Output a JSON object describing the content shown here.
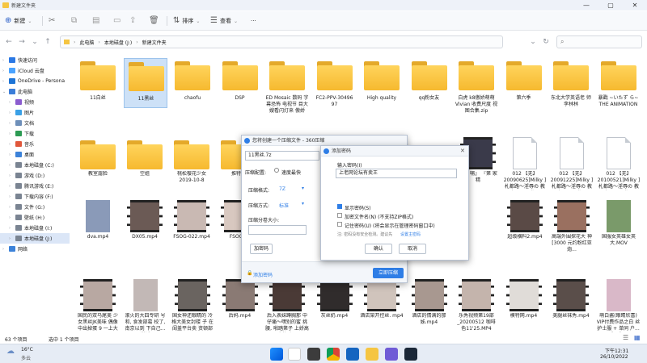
{
  "window": {
    "title": "新建文件夹"
  },
  "ribbon": {
    "new_label": "新建",
    "sort_label": "排序",
    "view_label": "查看",
    "more_label": "···"
  },
  "address": {
    "path": [
      "此电脑",
      "本地磁盘 (J:)",
      "新建文件夹"
    ]
  },
  "sidebar": {
    "items": [
      {
        "label": "快速访问",
        "color": "#2b78e4",
        "chev": "›",
        "indent": 0
      },
      {
        "label": "iCloud 云盘",
        "color": "#4aa3ff",
        "chev": "›",
        "indent": 0
      },
      {
        "label": "OneDrive - Persona",
        "color": "#1e74d6",
        "chev": "›",
        "indent": 0
      },
      {
        "label": "此电脑",
        "color": "#3b7dd8",
        "chev": "⌄",
        "indent": 0
      },
      {
        "label": "视频",
        "color": "#8b5ccf",
        "chev": "›",
        "indent": 1
      },
      {
        "label": "图片",
        "color": "#3aa0e6",
        "chev": "›",
        "indent": 1
      },
      {
        "label": "文档",
        "color": "#6e8fb9",
        "chev": "›",
        "indent": 1
      },
      {
        "label": "下载",
        "color": "#2c9b53",
        "chev": "›",
        "indent": 1
      },
      {
        "label": "音乐",
        "color": "#e0573b",
        "chev": "›",
        "indent": 1
      },
      {
        "label": "桌面",
        "color": "#3c82d9",
        "chev": "›",
        "indent": 1
      },
      {
        "label": "本地磁盘 (C:)",
        "color": "#7a8492",
        "chev": "›",
        "indent": 1
      },
      {
        "label": "游戏 (D:)",
        "color": "#7a8492",
        "chev": "›",
        "indent": 1
      },
      {
        "label": "腾讯游戏 (E:)",
        "color": "#7a8492",
        "chev": "›",
        "indent": 1
      },
      {
        "label": "下载内容 (F:)",
        "color": "#7a8492",
        "chev": "›",
        "indent": 1
      },
      {
        "label": "文件 (G:)",
        "color": "#7a8492",
        "chev": "›",
        "indent": 1
      },
      {
        "label": "壁纸 (H:)",
        "color": "#7a8492",
        "chev": "›",
        "indent": 1
      },
      {
        "label": "本地磁盘 (I:)",
        "color": "#7a8492",
        "chev": "›",
        "indent": 1
      },
      {
        "label": "本地磁盘 (J:)",
        "color": "#7a8492",
        "chev": "›",
        "indent": 1,
        "selected": true
      },
      {
        "label": "网络",
        "color": "#3c82d9",
        "chev": "›",
        "indent": 0
      }
    ]
  },
  "row1": [
    {
      "label": "11白丝"
    },
    {
      "label": "11黑丝",
      "selected": true
    },
    {
      "label": "chaofu"
    },
    {
      "label": "DSP"
    },
    {
      "label": "ED Mosaic 数码 字幕恐怖 电视节 目大嫂看闪灯来 傲娇"
    },
    {
      "label": "FC2-PPV-30496 97"
    },
    {
      "label": "High quality"
    },
    {
      "label": "qq粉女友"
    },
    {
      "label": "白虎 k8傲娇萌萌 Vivian 收费尺度 视图合集.zip"
    },
    {
      "label": "第六季"
    },
    {
      "label": "东北大学英语老 师李林林"
    },
    {
      "label": "暴戳 ~いたず ら~ THE ANIMATION"
    }
  ],
  "row2": [
    {
      "label": "教室露脸",
      "kind": "folder"
    },
    {
      "label": "空姐",
      "kind": "folder"
    },
    {
      "label": "桃松樱花少女 2019-10-8",
      "kind": "folder"
    },
    {
      "label": "推特福",
      "kind": "folder"
    },
    {
      "label": "『哺 哺』 『第 家 精",
      "kind": "video",
      "color": "#3a3a4a"
    },
    {
      "label": "012 【无】 20090625]Milky ]札都路～淫辱の 教室～ #1 私...",
      "kind": "doc"
    },
    {
      "label": "012 【无】 20091225]Milky ]札都路～淫辱の 教室～ #2 私...",
      "kind": "doc"
    },
    {
      "label": "012 【无】 20100521]Milky ]札都路～淫辱の 教室～ #3 私...",
      "kind": "doc"
    }
  ],
  "row3": [
    {
      "label": "dva.mp4",
      "kind": "photo",
      "color": "#8a9ab8"
    },
    {
      "label": "DX05.mp4",
      "kind": "video",
      "color": "#6b5a55"
    },
    {
      "label": "FSOG-022.mp4",
      "kind": "video",
      "color": "#c9b9b3"
    },
    {
      "label": "FSOG-0",
      "kind": "video",
      "color": "#d8c8c0"
    },
    {
      "label": "超级横料2.mp4",
      "kind": "video",
      "color": "#5a4a46"
    },
    {
      "label": "高端外围探花大 神[3000 元约粉红亚炮...",
      "kind": "video",
      "color": "#9a7060"
    },
    {
      "label": "国服女英雄女英 大.MOV",
      "kind": "photo",
      "color": "#7a9a6a"
    }
  ],
  "row4": [
    {
      "label": "国民的双马尾美 少女黑丝JK美味 偶像中出掉蛋 9 一上大黑K1V",
      "kind": "video",
      "color": "#b8a8a2"
    },
    {
      "label": "滚火的大四专研 号和, 食发部葛 校了, 南京以到 下自己...讲话",
      "kind": "photo",
      "color": "#c2b8b6"
    },
    {
      "label": "国女神还眼睛的 冷格大美女封楼 子 在闺盖平台卖 资顿部日开...",
      "kind": "video",
      "color": "#6a6460"
    },
    {
      "label": "后妈.mp4",
      "kind": "video",
      "color": "#8a7a74"
    },
    {
      "label": "后入表妹蹲胸那 中仔痛～嘿别的蜜 挑腰, 啪踏第子 上娇高喜的吐...",
      "kind": "video",
      "color": "#4a3a36"
    },
    {
      "label": "灰丝奶.mp4",
      "kind": "video",
      "color": "#302c2c"
    },
    {
      "label": "酒店架开控丝. mp4",
      "kind": "video",
      "color": "#d0c4bc"
    },
    {
      "label": "酒店的情满的那 姊.mp4",
      "kind": "video",
      "color": "#a89890"
    },
    {
      "label": "乐秀视频第19部 _20200512 咖啡 色11'25.MP4",
      "kind": "video",
      "color": "#c4b4ac"
    },
    {
      "label": "模特网.mp4",
      "kind": "video",
      "color": "#e0dcd8"
    },
    {
      "label": "美腿丝袜秀.mp4",
      "kind": "video",
      "color": "#5a4e4a"
    },
    {
      "label": "萌白酱(眼睛欣喜) VIP付费作品之白 丝护士服 + 单同 户...睡眠作品",
      "kind": "photo",
      "color": "#d9b8c8"
    }
  ],
  "status": {
    "count": "63 个项目",
    "selected": "选中 1 个项目"
  },
  "dialog": {
    "title": "您将创建一个压缩文件 - 360压缩",
    "filename": "11黑丝.7z",
    "level_label": "压缩配置:",
    "level_value": "速度最快",
    "format_label": "压缩格式:",
    "format_value": "7Z",
    "method_label": "压缩方式:",
    "method_value": "标准",
    "split_label": "压缩分卷大小:",
    "add_password": "加密码",
    "add_password_link": "添加密码",
    "start_button": "立即压缩"
  },
  "password_dialog": {
    "title": "添加密码",
    "input_label": "输入密码(I)",
    "input_value": "上老网论坛有卖王",
    "show_password": "显示密码(S)",
    "encrypt_names": "加密文件名(N) (不支持ZIP格式)",
    "remember": "记住密码(U) (将会显示在管理密码窗口中)",
    "tip": "注: 密码没有安全检测。建议先",
    "tip_link": "设置主密码",
    "ok": "确认",
    "cancel": "取消"
  },
  "taskbar": {
    "weather_temp": "16°C",
    "weather_desc": "多云",
    "time": "下午12:31",
    "date": "26/10/2022"
  }
}
